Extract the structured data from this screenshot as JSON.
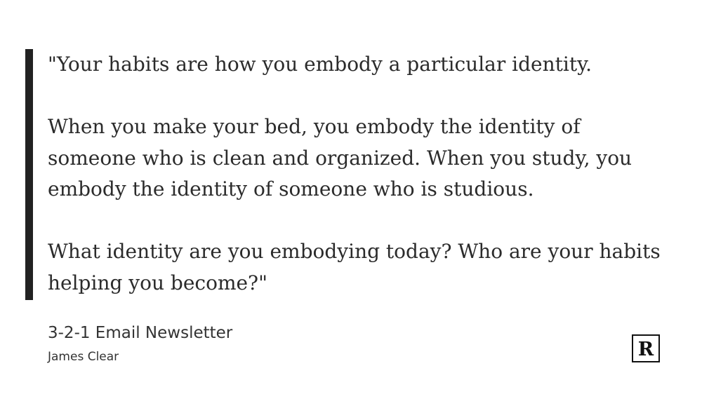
{
  "quote": {
    "paragraphs": [
      "\"Your habits are how you embody a particular identity.",
      "When you make your bed, you embody the identity of someone who is clean and organized. When you study, you embody the identity of someone who is studious.",
      "What identity are you embodying today? Who are your habits helping you become?\""
    ]
  },
  "source": {
    "title": "3-2-1 Email Newsletter",
    "author": "James Clear"
  },
  "logo": {
    "icon": "r-logo-icon",
    "letter": "R",
    "color": "#111111"
  },
  "colors": {
    "accent_bar": "#222222",
    "text": "#2b2b2b",
    "background": "#ffffff"
  }
}
